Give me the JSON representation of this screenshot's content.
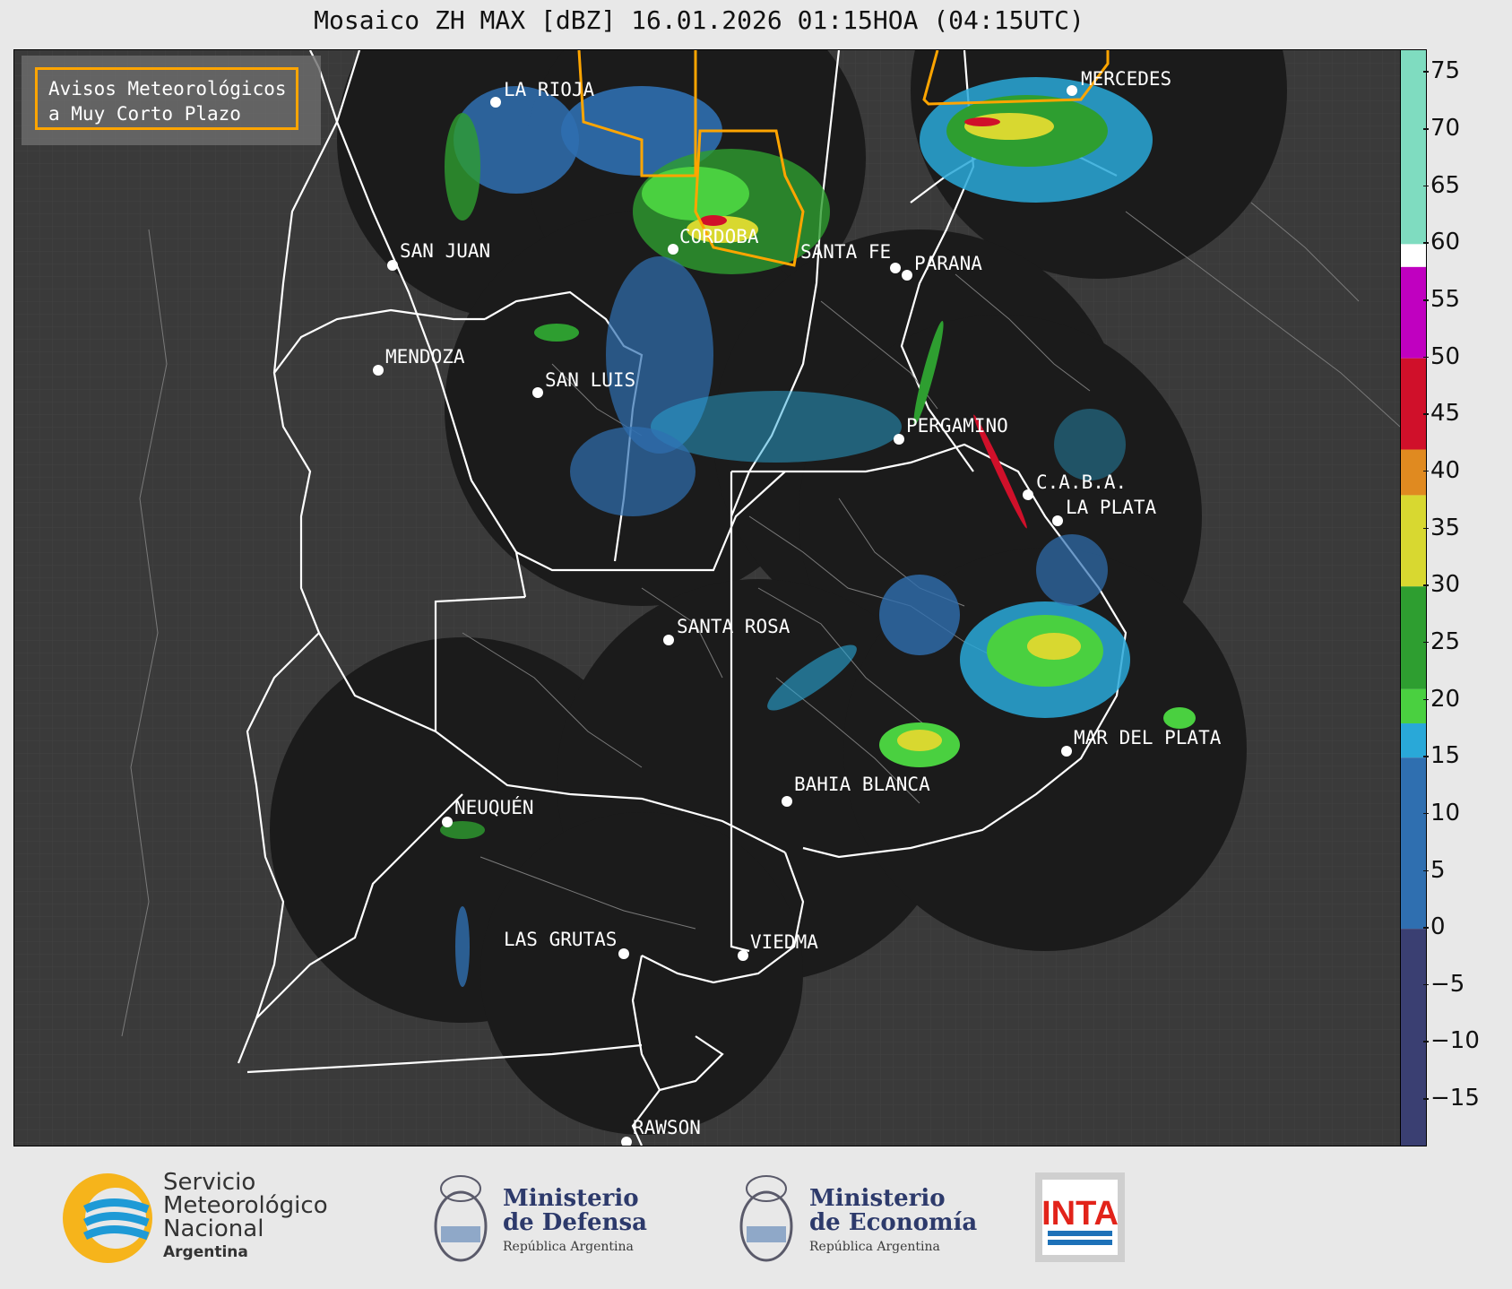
{
  "title": "Mosaico ZH MAX [dBZ] 16.01.2026 01:15HOA (04:15UTC)",
  "legend": {
    "line1": "Avisos Meteorológicos",
    "line2": "a Muy Corto Plazo"
  },
  "cities": [
    {
      "name": "LA RIOJA"
    },
    {
      "name": "MERCEDES"
    },
    {
      "name": "SAN JUAN"
    },
    {
      "name": "CORDOBA"
    },
    {
      "name": "SANTA FE"
    },
    {
      "name": "PARANA"
    },
    {
      "name": "MENDOZA"
    },
    {
      "name": "SAN LUIS"
    },
    {
      "name": "PERGAMINO"
    },
    {
      "name": "C.A.B.A."
    },
    {
      "name": "LA PLATA"
    },
    {
      "name": "SANTA ROSA"
    },
    {
      "name": "MAR DEL PLATA"
    },
    {
      "name": "BAHIA BLANCA"
    },
    {
      "name": "NEUQUÉN"
    },
    {
      "name": "LAS GRUTAS"
    },
    {
      "name": "VIEDMA"
    },
    {
      "name": "RAWSON"
    }
  ],
  "colorbar": {
    "ticks": [
      "75",
      "70",
      "65",
      "60",
      "55",
      "50",
      "45",
      "40",
      "35",
      "30",
      "25",
      "20",
      "15",
      "10",
      "5",
      "0",
      "−5",
      "−10",
      "−15"
    ],
    "range": [
      -19,
      77
    ],
    "colors": {
      "teal": "#7fdcc0",
      "white": "#ffffff",
      "magenta": "#c000c0",
      "red": "#d0102a",
      "orange": "#e08a20",
      "yellow": "#d8d830",
      "green": "#2e9e30",
      "light_green": "#4ad040",
      "cyan_blue": "#29a8d8",
      "blue": "#2f6fb0",
      "navy": "#3a3f72"
    }
  },
  "logos": {
    "smn": {
      "line1": "Servicio",
      "line2": "Meteorológico",
      "line3": "Nacional",
      "line4": "Argentina"
    },
    "defensa": {
      "line1": "Ministerio",
      "line2": "de Defensa",
      "line3": "República Argentina"
    },
    "economia": {
      "line1": "Ministerio",
      "line2": "de Economía",
      "line3": "República Argentina"
    },
    "inta": {
      "text": "INTA"
    }
  }
}
